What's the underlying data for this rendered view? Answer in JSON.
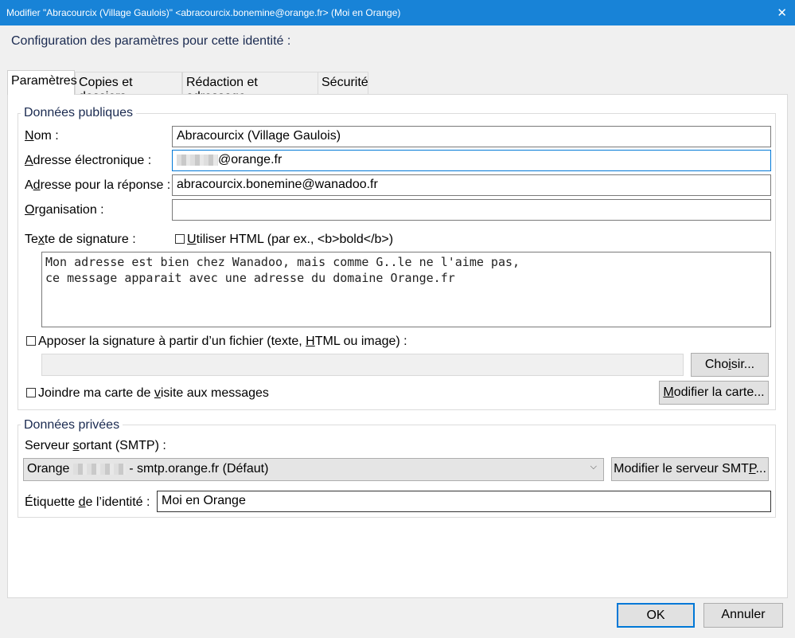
{
  "window": {
    "title": "Modifier \"Abracourcix (Village Gaulois)\" <abracourcix.bonemine@orange.fr> (Moi en Orange)",
    "close": "✕"
  },
  "heading": "Configuration des paramètres pour cette identité :",
  "tabs": [
    "Paramètres",
    "Copies et dossiers",
    "Rédaction et adressage",
    "Sécurité"
  ],
  "public_data": {
    "legend": "Données publiques",
    "name_label_u": "N",
    "name_label_rest": "om :",
    "name_value": "Abracourcix (Village Gaulois)",
    "email_label_u": "A",
    "email_label_rest": "dresse électronique :",
    "email_value": "@orange.fr",
    "reply_label_pre": "A",
    "reply_label_u": "d",
    "reply_label_rest": "resse pour la réponse :",
    "reply_value": "abracourcix.bonemine@wanadoo.fr",
    "org_label_u": "O",
    "org_label_rest": "rganisation :",
    "org_value": "",
    "signature_label_pre": "Te",
    "signature_label_u": "x",
    "signature_label_rest": "te de signature :",
    "use_html_u": "U",
    "use_html_rest": "tiliser HTML (par ex., <b>bold</b>)",
    "signature_text": "Mon adresse est bien chez Wanadoo, mais comme G..le ne l'aime pas,\nce message apparait avec une adresse du domaine Orange.fr",
    "attach_sig_pre": "Apposer la signature à partir d’un fichier (texte, ",
    "attach_sig_u": "H",
    "attach_sig_rest": "TML ou image) :",
    "file_path": "",
    "choose_pre": "Cho",
    "choose_u": "i",
    "choose_rest": "sir...",
    "vcard_pre": "Joindre ma carte de ",
    "vcard_u": "v",
    "vcard_rest": "isite aux messages",
    "edit_card_u": "M",
    "edit_card_rest": "odifier la carte..."
  },
  "private_data": {
    "legend": "Données privées",
    "smtp_label_pre": "Serveur ",
    "smtp_label_u": "s",
    "smtp_label_rest": "ortant (SMTP) :",
    "smtp_value_pre": "Orange",
    "smtp_value_rest": " - smtp.orange.fr (Défaut)",
    "edit_smtp_pre": "Modifier le serveur SMT",
    "edit_smtp_u": "P",
    "edit_smtp_rest": "...",
    "identity_label_pre": "Étiquette ",
    "identity_label_u": "d",
    "identity_label_rest": "e l’identité :",
    "identity_value": "Moi en Orange"
  },
  "buttons": {
    "ok": "OK",
    "cancel": "Annuler"
  },
  "icons": {
    "combo_arrow": "chevron-down-icon",
    "close": "close-icon"
  },
  "colors": {
    "titlebar": "#1883d7",
    "focus": "#0078d7"
  }
}
